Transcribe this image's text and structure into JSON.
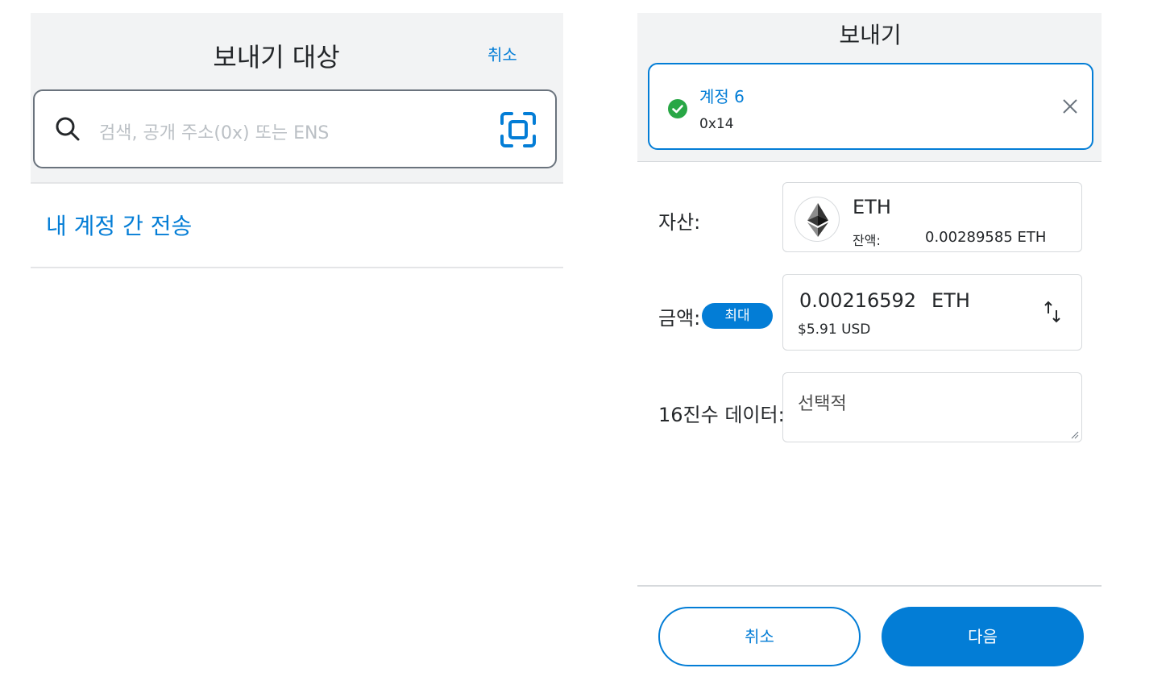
{
  "left": {
    "title": "보내기 대상",
    "cancel_label": "취소",
    "search": {
      "placeholder": "검색, 공개 주소(0x) 또는 ENS",
      "icon": "search-icon",
      "scan_icon": "scan-icon"
    },
    "transfer_link": "내 계정 간 전송"
  },
  "right": {
    "title": "보내기",
    "account": {
      "name": "계정 6",
      "address": "0x14",
      "status_icon": "check-circle-icon",
      "close_icon": "close-icon"
    },
    "fields": {
      "asset_label": "자산:",
      "amount_label": "금액:",
      "max_label": "최대",
      "hex_label": "16진수 데이터:"
    },
    "asset": {
      "symbol": "ETH",
      "balance_label": "잔액:",
      "balance_value": "0.00289585 ETH",
      "icon": "eth-icon"
    },
    "amount": {
      "value": "0.00216592",
      "unit": "ETH",
      "fiat": "$5.91 USD",
      "swap_icon": "swap-icon"
    },
    "hex": {
      "placeholder": "선택적"
    },
    "footer": {
      "cancel_label": "취소",
      "next_label": "다음"
    }
  },
  "colors": {
    "accent": "#037dd6",
    "success": "#28a745",
    "header_bg": "#f2f3f4"
  }
}
